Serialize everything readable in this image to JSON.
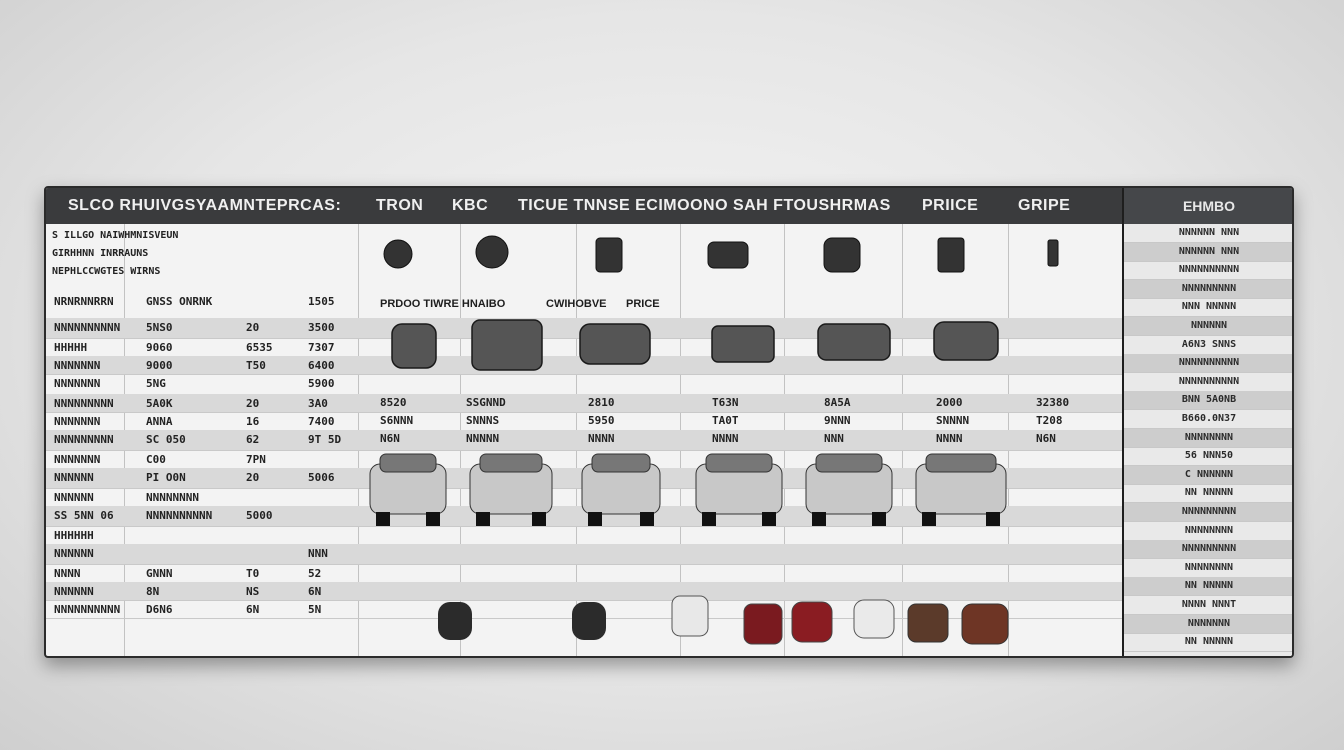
{
  "header": {
    "col_a": "SLCO RHUIVGSYAAMNTEPRCAS:",
    "col_b": "TRON",
    "col_c": "KBC",
    "col_d": "TICUE TNNSE ECIMOONO SAH FTOUSHRMAS",
    "col_e": "PRIICE",
    "col_f": "GRIPE",
    "col_g": "EHMBO"
  },
  "top_left_notes": [
    "S ILLGO NAIWHMNISVEUN",
    "GIRHHNN INRRAUNS",
    "NEPHLCCWGTES WIRNS"
  ],
  "subheads": [
    "PRDOO TIWRE HNAIBO",
    "CWIHOBVE",
    "PRICE"
  ],
  "rows": [
    {
      "a": "NRNRNNRRN",
      "b": "GNSS ONRNK",
      "c": "",
      "d": "1505"
    },
    {
      "a": "NNNNNNNNNN",
      "b": "5NS0",
      "c": "20",
      "d": "3500"
    },
    {
      "a": "HHHHH",
      "b": "9060",
      "c": "6535",
      "d": "7307"
    },
    {
      "a": "NNNNNNN",
      "b": "9000",
      "c": "T50",
      "d": "6400"
    },
    {
      "a": "NNNNNNN",
      "b": "5NG",
      "c": "",
      "d": "5900"
    },
    {
      "a": "NNNNNNNNN",
      "b": "5A0K",
      "c": "20",
      "d": "3A0"
    },
    {
      "a": "NNNNNNN",
      "b": "ANNA",
      "c": "16",
      "d": "7400"
    },
    {
      "a": "NNNNNNNNN",
      "b": "SC 050",
      "c": "62",
      "d": "9T 5D"
    },
    {
      "a": "NNNNNNN",
      "b": "C00",
      "c": "7PN",
      "d": ""
    },
    {
      "a": "NNNNNN",
      "b": "PI O0N",
      "c": "20",
      "d": "5006"
    },
    {
      "a": "NNNNNN",
      "b": "NNNNNNNN",
      "c": "",
      "d": ""
    },
    {
      "a": "SS 5NN 06",
      "b": "NNNNNNNNNN",
      "c": "5000",
      "d": ""
    },
    {
      "a": "HHHHHH",
      "b": "",
      "c": "",
      "d": ""
    },
    {
      "a": "NNNNNN",
      "b": "",
      "c": "",
      "d": "NNN"
    },
    {
      "a": "NNNN",
      "b": "GNNN",
      "c": "T0",
      "d": "52"
    },
    {
      "a": "NNNNNN",
      "b": "8N",
      "c": "NS",
      "d": "6N"
    },
    {
      "a": "NNNNNNNNNN",
      "b": "D6N6",
      "c": "6N",
      "d": "5N"
    }
  ],
  "value_row_1": [
    "8520",
    "SSGNND",
    "2810",
    "T63N",
    "8A5A",
    "2000",
    "32380"
  ],
  "value_row_2": [
    "S6NNN",
    "SNNNS",
    "5950",
    "TA0T",
    "9NNN",
    "SNNNN",
    "T208"
  ],
  "value_row_3": [
    "N6N",
    "NNNNN",
    "NNNN",
    "NNNN",
    "NNN",
    "NNNN",
    "N6N"
  ],
  "right_column": [
    "NNNNNN NNN",
    "NNNNNN NNN",
    "NNNNNNNNNN",
    "NNNNNNNNN",
    "NNN NNNNN",
    "NNNNNN",
    "A6N3 SNNS",
    "NNNNNNNNNN",
    "NNNNNNNNNN",
    "BNN 5A0NB",
    "B660.0N37",
    "NNNNNNNN",
    "56 NNN50",
    "C NNNNNN",
    "NN NNNNN",
    "NNNNNNNNN",
    "NNNNNNNN",
    "NNNNNNNNN",
    "NNNNNNNN",
    "NN NNNNN",
    "NNNN NNNT",
    "NNNNNNN",
    "NN NNNNN"
  ]
}
